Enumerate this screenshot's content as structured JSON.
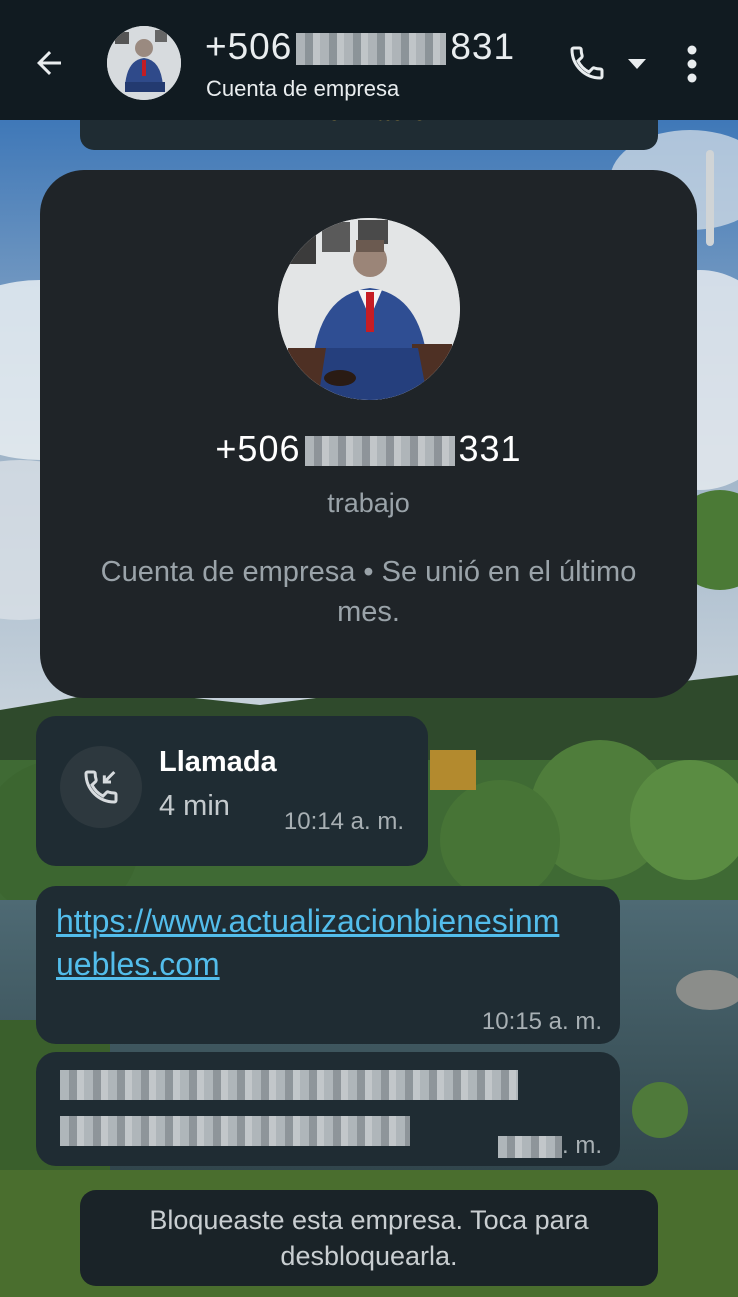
{
  "header": {
    "title_prefix": "+506",
    "title_suffix": "831",
    "subtitle": "Cuenta de empresa",
    "icons": {
      "back": "arrow-back-icon",
      "call": "phone-icon",
      "caret": "caret-down-icon",
      "menu": "more-vert-icon"
    }
  },
  "chat": {
    "previous_bubble_text": "Información",
    "contact_card": {
      "phone_prefix": "+506",
      "phone_suffix": "331",
      "label": "trabajo",
      "description": "Cuenta de empresa • Se unió en el último mes."
    },
    "call_message": {
      "title": "Llamada",
      "duration": "4 min",
      "time": "10:14 a. m."
    },
    "link_message": {
      "url": "https://www.actualizacionbienesinmuebles.com",
      "time": "10:15 a. m."
    },
    "redacted_message": {
      "time_suffix": ". m."
    },
    "system_message": "Bloqueaste esta empresa. Toca para desbloquearla."
  },
  "colors": {
    "header_bg": "#111b21",
    "bubble_bg": "#1f2c33",
    "link": "#53bdeb",
    "card_bg": "#1f2428"
  }
}
